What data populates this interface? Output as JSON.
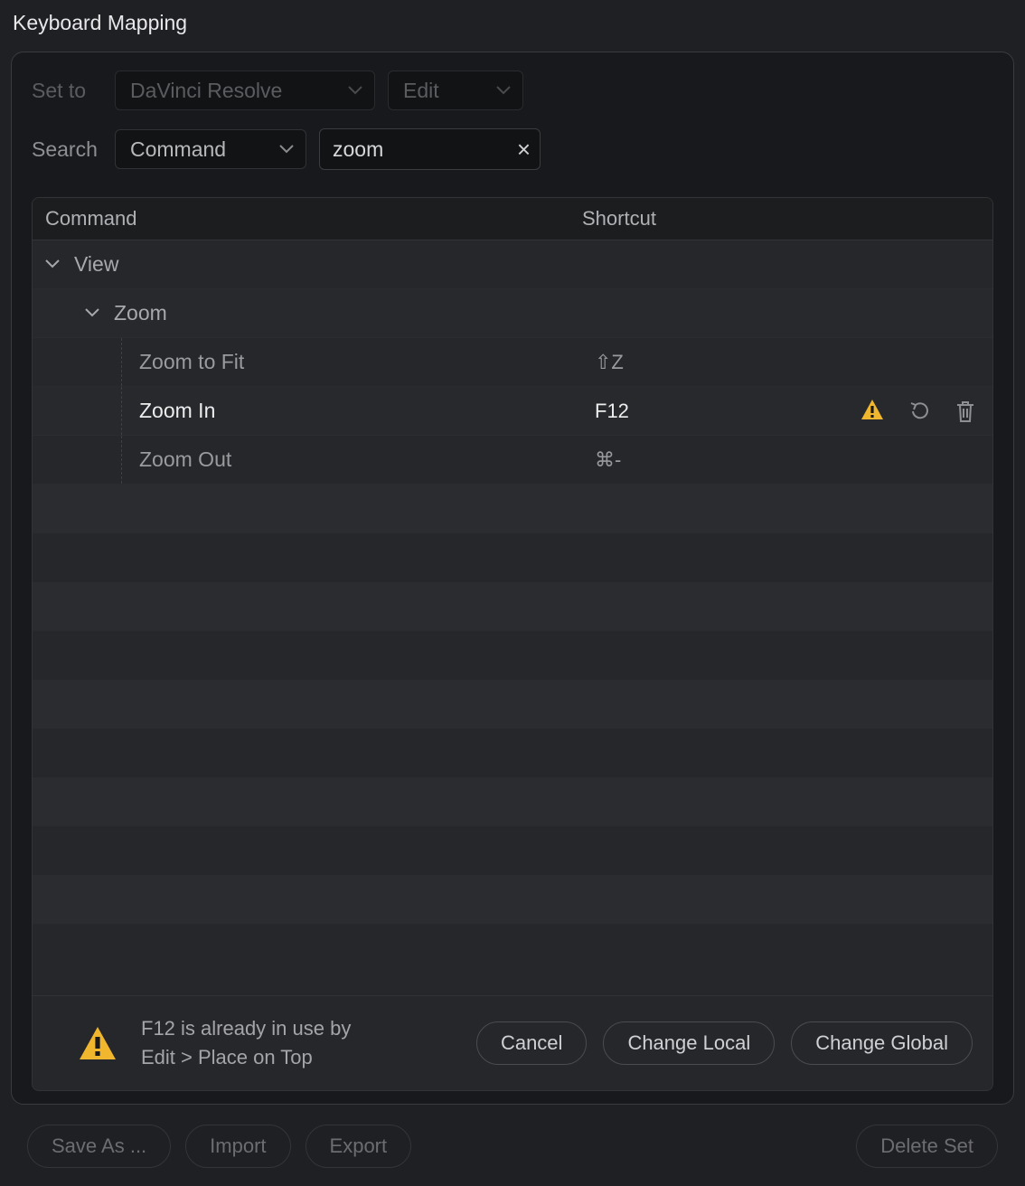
{
  "title": "Keyboard Mapping",
  "toolbar": {
    "set_to_label": "Set to",
    "preset": "DaVinci Resolve",
    "context": "Edit",
    "search_label": "Search",
    "search_mode": "Command",
    "search_value": "zoom"
  },
  "columns": {
    "command": "Command",
    "shortcut": "Shortcut"
  },
  "tree": {
    "group1": "View",
    "group2": "Zoom",
    "rows": [
      {
        "label": "Zoom to Fit",
        "shortcut": "⇧Z",
        "selected": false,
        "conflict": false
      },
      {
        "label": "Zoom In",
        "shortcut": "F12",
        "selected": true,
        "conflict": true
      },
      {
        "label": "Zoom Out",
        "shortcut": "⌘-",
        "selected": false,
        "conflict": false
      }
    ]
  },
  "conflict": {
    "line1": "F12 is already in use by",
    "line2": "Edit > Place on Top",
    "cancel": "Cancel",
    "change_local": "Change Local",
    "change_global": "Change Global"
  },
  "bottom": {
    "save_as": "Save As ...",
    "import": "Import",
    "export": "Export",
    "delete_set": "Delete Set"
  }
}
